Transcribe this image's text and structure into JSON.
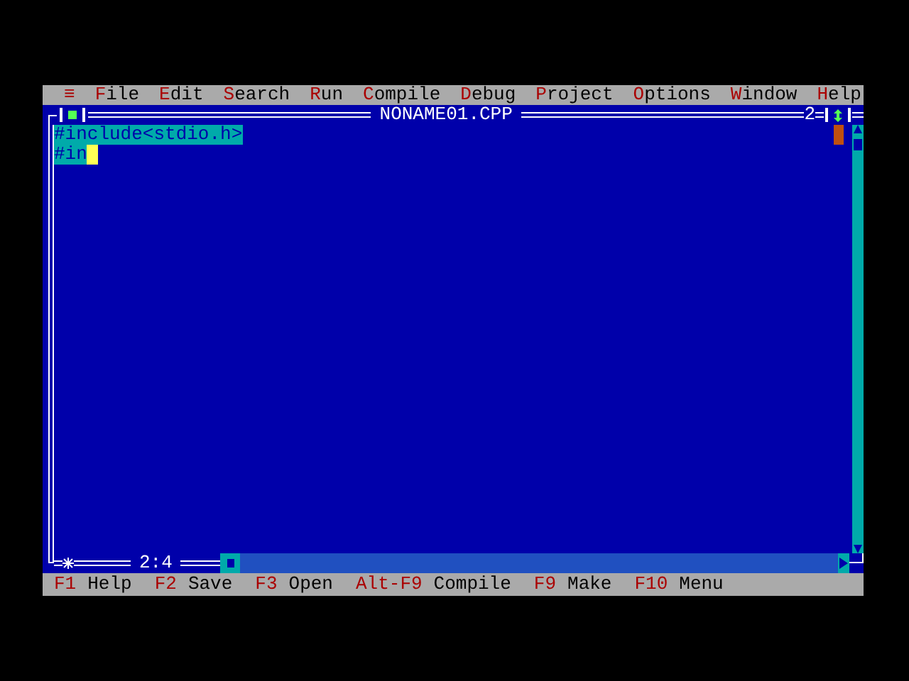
{
  "menu": {
    "left": [
      {
        "label": "≡"
      },
      {
        "label": "File"
      },
      {
        "label": "Edit"
      },
      {
        "label": "Search"
      },
      {
        "label": "Run"
      },
      {
        "label": "Compile"
      },
      {
        "label": "Debug"
      },
      {
        "label": "Project"
      },
      {
        "label": "Options"
      }
    ],
    "right": [
      {
        "label": "Window"
      },
      {
        "label": "Help"
      }
    ]
  },
  "editor": {
    "title": "NONAME01.CPP",
    "window_number": "2",
    "position": "2:4",
    "lines": [
      {
        "text": "#include<stdio.h>",
        "selected": true
      },
      {
        "text": "#in",
        "selected": true
      }
    ]
  },
  "status_bar": [
    {
      "key": "F1",
      "label": "Help"
    },
    {
      "key": "F2",
      "label": "Save"
    },
    {
      "key": "F3",
      "label": "Open"
    },
    {
      "key": "Alt-F9",
      "label": "Compile"
    },
    {
      "key": "F9",
      "label": "Make"
    },
    {
      "key": "F10",
      "label": "Menu"
    }
  ]
}
